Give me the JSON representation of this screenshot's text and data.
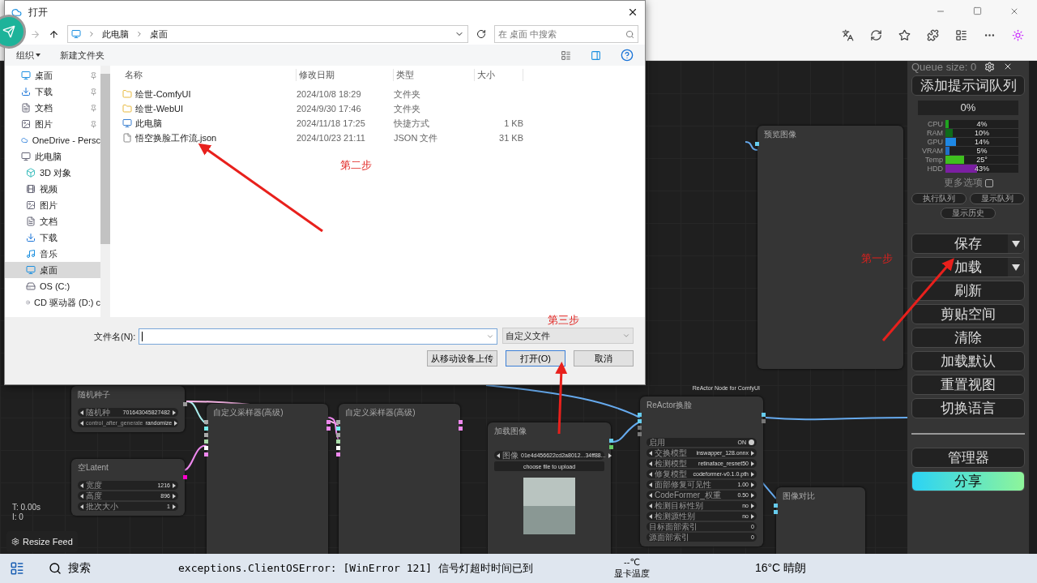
{
  "dialog": {
    "title": "打开",
    "path": [
      "此电脑",
      "桌面"
    ],
    "search_placeholder": "在 桌面 中搜索",
    "toolbar": [
      {
        "label": "组织",
        "dropdown": true
      },
      {
        "label": "新建文件夹",
        "dropdown": false
      }
    ],
    "sidebar": [
      {
        "label": "桌面",
        "kind": "desktop",
        "pinned": true,
        "selected": false
      },
      {
        "label": "下载",
        "kind": "download",
        "pinned": true,
        "selected": false
      },
      {
        "label": "文档",
        "kind": "document",
        "pinned": true,
        "selected": false
      },
      {
        "label": "图片",
        "kind": "picture",
        "pinned": true,
        "selected": false
      },
      {
        "label": "OneDrive - Persc",
        "kind": "cloud",
        "pinned": false,
        "selected": false
      },
      {
        "label": "此电脑",
        "kind": "computer",
        "pinned": false,
        "selected": false,
        "children": [
          {
            "label": "3D 对象",
            "kind": "object3d",
            "pinned": false,
            "selected": false
          },
          {
            "label": "视频",
            "kind": "video",
            "pinned": false,
            "selected": false
          },
          {
            "label": "图片",
            "kind": "picture",
            "pinned": false,
            "selected": false
          },
          {
            "label": "文档",
            "kind": "document",
            "pinned": false,
            "selected": false
          },
          {
            "label": "下载",
            "kind": "download",
            "pinned": false,
            "selected": false
          },
          {
            "label": "音乐",
            "kind": "music",
            "pinned": false,
            "selected": false
          },
          {
            "label": "桌面",
            "kind": "desktop",
            "pinned": false,
            "selected": true
          },
          {
            "label": "OS (C:)",
            "kind": "drive",
            "pinned": false,
            "selected": false
          },
          {
            "label": "CD 驱动器 (D:) c",
            "kind": "disc",
            "pinned": false,
            "selected": false
          }
        ]
      }
    ],
    "columns": [
      "名称",
      "修改日期",
      "类型",
      "大小"
    ],
    "files": [
      {
        "name": "绘世-ComfyUI",
        "modified": "2024/10/8 18:29",
        "type": "文件夹",
        "kind": "folder"
      },
      {
        "name": "绘世-WebUI",
        "modified": "2024/9/30 17:46",
        "type": "文件夹",
        "kind": "folder"
      },
      {
        "name": "此电脑",
        "modified": "2024/11/18 17:25",
        "type": "快捷方式",
        "size": "1 KB",
        "kind": "shortcut"
      },
      {
        "name": "悟空换脸工作流.json",
        "modified": "2024/10/23 21:11",
        "type": "JSON 文件",
        "size": "31 KB",
        "kind": "file"
      }
    ],
    "filename_label": "文件名(N):",
    "filter": "自定义文件",
    "buttons": [
      {
        "label": "从移动设备上传",
        "primary": false
      },
      {
        "label": "打开(O)",
        "primary": true
      },
      {
        "label": "取消",
        "primary": false
      }
    ]
  },
  "canvas": {
    "nodes": [
      {
        "title": "随机种子",
        "fields": [
          {
            "kind": "combo",
            "label": "随机种",
            "value": "701643045827482"
          },
          {
            "kind": "combo",
            "label": "control_after_generate",
            "value": "randomize"
          }
        ]
      },
      {
        "title": "空Latent",
        "fields": [
          {
            "kind": "combo",
            "label": "宽度",
            "value": "1216"
          },
          {
            "kind": "combo",
            "label": "高度",
            "value": "896"
          },
          {
            "kind": "combo",
            "label": "批次大小",
            "value": "1"
          }
        ]
      },
      {
        "title": "自定义采样器(高级)"
      },
      {
        "title": "自定义采样器(高级)"
      },
      {
        "title": "加载图像",
        "fields": [
          {
            "kind": "combo",
            "label": "图像",
            "value": "01e4d456622cd2a8012...34ff88..."
          },
          {
            "kind": "button",
            "label": "choose file to upload"
          }
        ],
        "image": true
      },
      {
        "title": "ReActor换脸",
        "caption": "ReActor Node for ComfyUI",
        "fields": [
          {
            "kind": "toggle",
            "label": "启用",
            "value": "ON",
            "on": true
          },
          {
            "kind": "combo",
            "label": "交换模型",
            "value": "inswapper_128.onnx"
          },
          {
            "kind": "combo",
            "label": "检测模型",
            "value": "retinaface_resnet50"
          },
          {
            "kind": "combo",
            "label": "修复模型",
            "value": "codeformer-v0.1.0.pth"
          },
          {
            "kind": "combo",
            "label": "面部修复可见性",
            "value": "1.00"
          },
          {
            "kind": "combo",
            "label": "CodeFormer_权重",
            "value": "0.50"
          },
          {
            "kind": "combo",
            "label": "检测目标性别",
            "value": "no"
          },
          {
            "kind": "combo",
            "label": "检测源性别",
            "value": "no"
          },
          {
            "kind": "number",
            "label": "目标面部索引",
            "value": "0"
          },
          {
            "kind": "number",
            "label": "源面部索引",
            "value": "0"
          }
        ]
      },
      {
        "title": "图像对比"
      },
      {
        "title": "预览图像"
      }
    ],
    "stats": [
      "T: 0.00s",
      "I: 0"
    ],
    "resize_button": "Resize Feed"
  },
  "panel": {
    "queue": "Queue size: 0",
    "queue_button": "添加提示词队列",
    "progress": "0%",
    "meters": [
      {
        "name": "CPU",
        "reading": "4%",
        "level": 0.04,
        "color": "#1fa51f"
      },
      {
        "name": "RAM",
        "reading": "10%",
        "level": 0.1,
        "color": "#0f6b1a"
      },
      {
        "name": "GPU",
        "reading": "14%",
        "level": 0.14,
        "color": "#1e88e5"
      },
      {
        "name": "VRAM",
        "reading": "5%",
        "level": 0.05,
        "color": "#1f6fc8"
      },
      {
        "name": "Temp",
        "reading": "25°",
        "level": 0.25,
        "color": "#3fbf1f"
      },
      {
        "name": "HDD",
        "reading": "43%",
        "level": 0.43,
        "color": "#7b1fa2"
      }
    ],
    "more_options": {
      "label": "更多选项",
      "checked": false
    },
    "small_buttons": [
      "执行队列",
      "显示队列",
      "显示历史"
    ],
    "buttons": [
      {
        "label": "保存",
        "kind": "dropdown"
      },
      {
        "label": "加载",
        "kind": "dropdown"
      },
      {
        "label": "刷新",
        "kind": "plain"
      },
      {
        "label": "剪贴空间",
        "kind": "plain"
      },
      {
        "label": "清除",
        "kind": "plain"
      },
      {
        "label": "加载默认",
        "kind": "plain"
      },
      {
        "label": "重置视图",
        "kind": "plain"
      },
      {
        "label": "切换语言",
        "kind": "plain"
      }
    ],
    "footer_buttons": [
      {
        "label": "管理器",
        "kind": "plain"
      },
      {
        "label": "分享",
        "kind": "gradient"
      }
    ]
  },
  "annotations": [
    "第一步",
    "第二步",
    "第三步"
  ],
  "taskbar": {
    "search": "搜索",
    "console": "exceptions.ClientOSError: [WinError 121] 信号灯超时时间已到",
    "gpu_temp": "--℃",
    "gpu_label": "显卡温度",
    "weather": "16°C 晴朗"
  }
}
